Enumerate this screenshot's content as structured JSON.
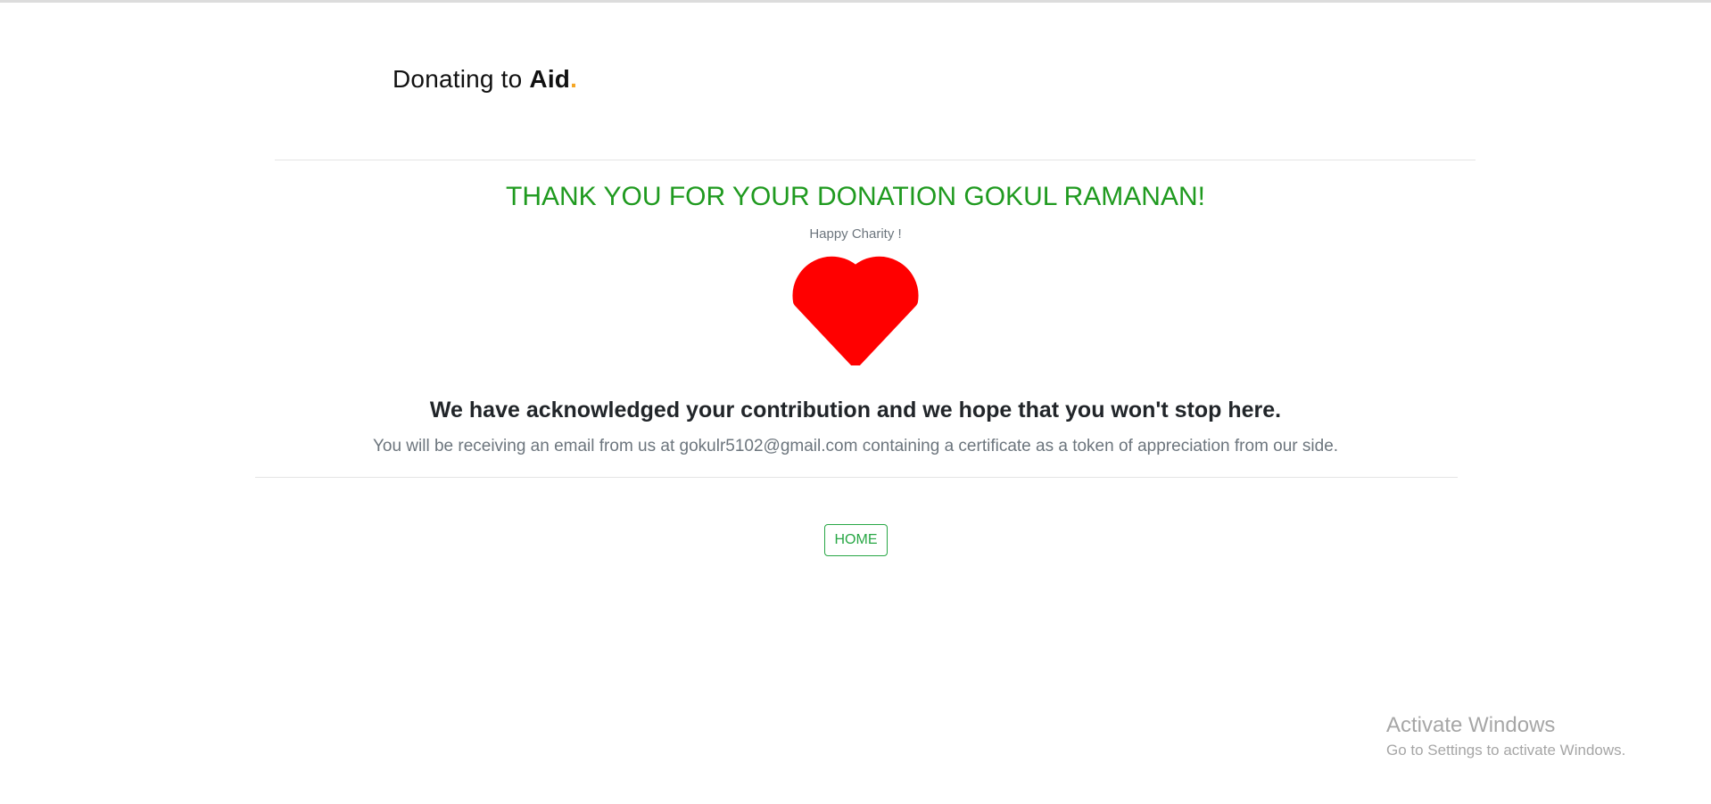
{
  "header": {
    "brand_prefix": "Donating to ",
    "brand_name": "Aid",
    "brand_dot": "."
  },
  "main": {
    "thank_you": "THANK YOU FOR YOUR DONATION GOKUL RAMANAN!",
    "subtitle": "Happy Charity !",
    "heart_icon": "heart-icon",
    "acknowledgement": "We have acknowledged your contribution and we hope that you won't stop here.",
    "email_message": "You will be receiving an email from us at gokulr5102@gmail.com containing a certificate as a token of appreciation from our side.",
    "home_button": "HOME"
  },
  "watermark": {
    "title": "Activate Windows",
    "subtitle": "Go to Settings to activate Windows."
  },
  "colors": {
    "accent_green": "#28a745",
    "thanks_green": "#1f9a1f",
    "heart_red": "#ff0000",
    "brand_dot": "#f5a623"
  }
}
